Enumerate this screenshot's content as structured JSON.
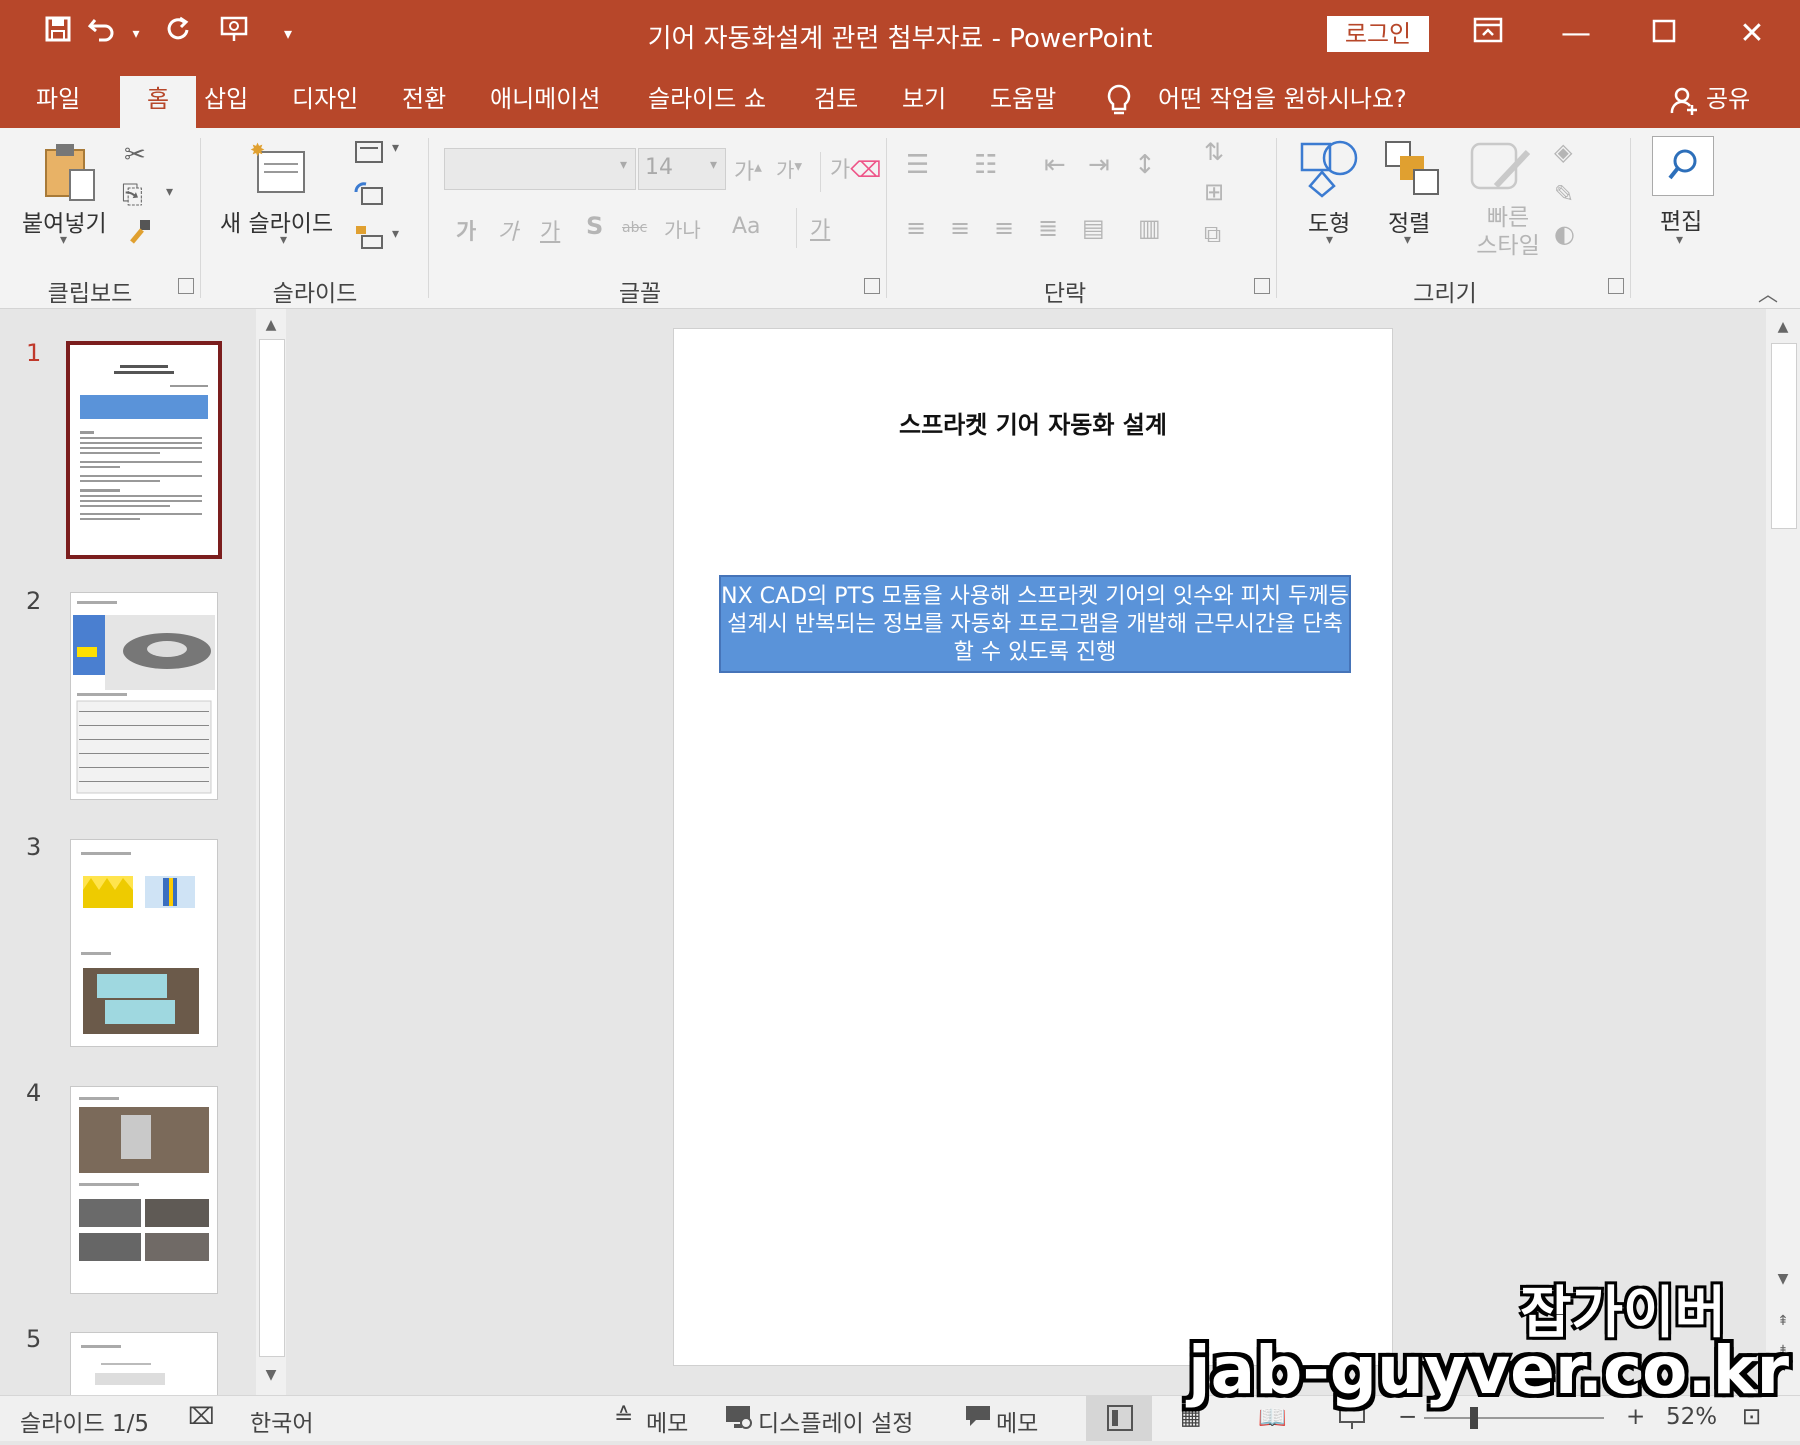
{
  "window": {
    "title": "기어 자동화설계 관련 첨부자료  -  PowerPoint",
    "login_label": "로그인",
    "accent_color": "#b7472a"
  },
  "quick_access": {
    "icons": [
      "save-icon",
      "undo-icon",
      "redo-icon",
      "present-icon",
      "customize-icon"
    ]
  },
  "menu": {
    "tabs": [
      "파일",
      "홈",
      "삽입",
      "디자인",
      "전환",
      "애니메이션",
      "슬라이드 쇼",
      "검토",
      "보기",
      "도움말"
    ],
    "active_tab": "홈",
    "tell_me": "어떤 작업을 원하시나요?",
    "share": "공유"
  },
  "ribbon": {
    "clipboard": {
      "label": "클립보드",
      "paste": "붙여넣기"
    },
    "slides": {
      "label": "슬라이드",
      "new_slide": "새 슬라이드"
    },
    "font": {
      "label": "글꼴",
      "size": "14",
      "glyphs": [
        "가",
        "가",
        "가",
        "S",
        "가나",
        "Aa",
        "가"
      ]
    },
    "paragraph": {
      "label": "단락"
    },
    "drawing": {
      "label": "그리기",
      "shapes": "도형",
      "arrange": "정렬",
      "quick_styles": "빠른 스타일"
    },
    "editing": {
      "label": "편집"
    }
  },
  "thumbnails": [
    {
      "number": "1",
      "selected": true
    },
    {
      "number": "2",
      "selected": false
    },
    {
      "number": "3",
      "selected": false
    },
    {
      "number": "4",
      "selected": false
    },
    {
      "number": "5",
      "selected": false
    }
  ],
  "slide": {
    "title": "스프라켓 기어 자동화 설계",
    "box_text": "NX CAD의 PTS 모듈을 사용해 스프라켓 기어의 잇수와 피치 두께등 설계시 반복되는 정보를 자동화 프로그램을 개발해 근무시간을 단축할 수 있도록 진행"
  },
  "status": {
    "slide_counter": "슬라이드 1/5",
    "language": "한국어",
    "notes": "메모",
    "display_settings": "디스플레이 설정",
    "comments": "메모",
    "zoom": "52%"
  },
  "watermark": {
    "line1": "잡가이버",
    "line2": "jab-guyver.co.kr"
  }
}
